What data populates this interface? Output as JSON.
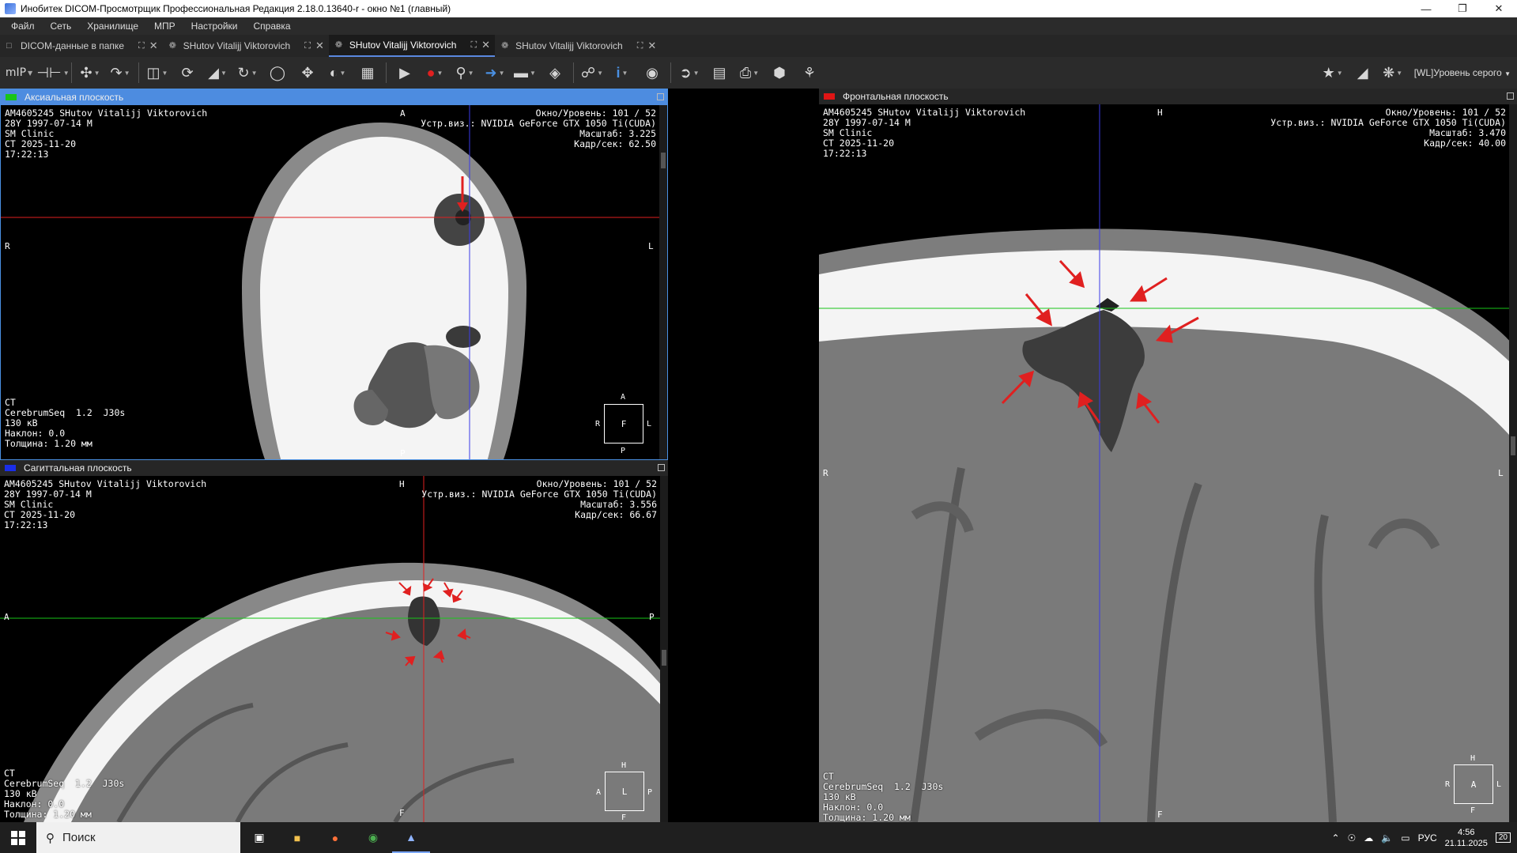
{
  "window": {
    "title": "Инобитек DICOM-Просмотрщик Профессиональная Редакция 2.18.0.13640-r - окно №1 (главный)"
  },
  "menu": [
    "Файл",
    "Сеть",
    "Хранилище",
    "МПР",
    "Настройки",
    "Справка"
  ],
  "tabs": [
    {
      "label": "DICOM-данные в папке",
      "active": false
    },
    {
      "label": "SHutov Vitalijj Viktorovich",
      "active": false
    },
    {
      "label": "SHutov Vitalijj Viktorovich",
      "active": true
    },
    {
      "label": "SHutov Vitalijj Viktorovich",
      "active": false
    }
  ],
  "toolbar": {
    "mip_label": "mIP",
    "wl_label": "[WL]Уровень серого"
  },
  "viewports": {
    "axial": {
      "title": "Аксиальная плоскость",
      "color": "#19c519",
      "tl": "AM4605245 SHutov Vitalijj Viktorovich\n28Y 1997-07-14 M\nSM Clinic\nCT 2025-11-20\n17:22:13",
      "tr": "Окно/Уровень: 101 / 52\nУстр.виз.: NVIDIA GeForce GTX 1050 Ti(CUDA)\nМасштаб: 3.225\nКадр/сек: 62.50",
      "bl": "CT\nCerebrumSeq  1.2  J30s\n130 кВ\nНаклон: 0.0\nТолщина: 1.20 мм",
      "orient": {
        "top": "A",
        "bottom": "P",
        "left": "R",
        "right": "L"
      },
      "cube": {
        "center": "F",
        "top": "A",
        "bottom": "P",
        "left": "R",
        "right": "L"
      }
    },
    "sagittal": {
      "title": "Сагиттальная плоскость",
      "color": "#1a2ee8",
      "tl": "AM4605245 SHutov Vitalijj Viktorovich\n28Y 1997-07-14 M\nSM Clinic\nCT 2025-11-20\n17:22:13",
      "tr": "Окно/Уровень: 101 / 52\nУстр.виз.: NVIDIA GeForce GTX 1050 Ti(CUDA)\nМасштаб: 3.556\nКадр/сек: 66.67",
      "bl": "CT\nCerebrumSeq  1.2  J30s\n130 кВ\nНаклон: 0.0\nТолщина: 1.20 мм",
      "orient": {
        "top": "H",
        "bottom": "F",
        "left": "A",
        "right": "P"
      },
      "cube": {
        "center": "L",
        "top": "H",
        "bottom": "F",
        "left": "A",
        "right": "P"
      }
    },
    "frontal": {
      "title": "Фронтальная плоскость",
      "color": "#e01515",
      "tl": "AM4605245 SHutov Vitalijj Viktorovich\n28Y 1997-07-14 M\nSM Clinic\nCT 2025-11-20\n17:22:13",
      "tr": "Окно/Уровень: 101 / 52\nУстр.виз.: NVIDIA GeForce GTX 1050 Ti(CUDA)\nМасштаб: 3.470\nКадр/сек: 40.00",
      "bl": "CT\nCerebrumSeq  1.2  J30s\n130 кВ\nНаклон: 0.0\nТолщина: 1.20 мм",
      "orient": {
        "top": "H",
        "bottom": "F",
        "left": "R",
        "right": "L"
      },
      "cube": {
        "center": "A",
        "top": "H",
        "bottom": "F",
        "left": "R",
        "right": "L"
      }
    }
  },
  "taskbar": {
    "search_placeholder": "Поиск",
    "lang": "РУС",
    "time": "4:56",
    "date": "21.11.2025",
    "notif_count": "20"
  }
}
